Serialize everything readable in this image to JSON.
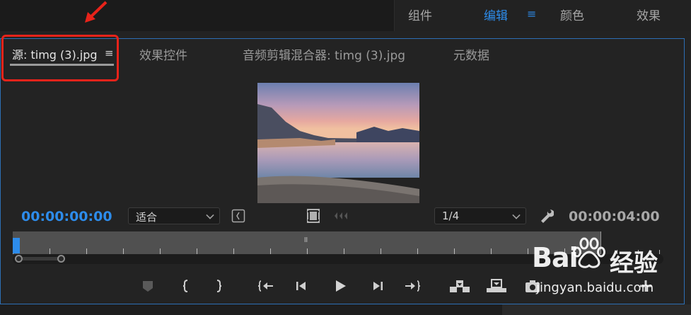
{
  "workspace_tabs": [
    "组件",
    "编辑",
    "颜色",
    "效果"
  ],
  "workspace_active": "编辑",
  "panel_tabs": {
    "source": "源: timg (3).jpg",
    "effect_controls": "效果控件",
    "audio_clip_mixer": "音频剪辑混合器: timg (3).jpg",
    "metadata": "元数据"
  },
  "timecode_in": "00:00:00:00",
  "timecode_duration": "00:00:04:00",
  "zoom_select": "适合",
  "resolution_select": "1/4",
  "watermark": {
    "brand": "Bai",
    "brand_suffix": "经验",
    "url": "jingyan.baidu.com"
  },
  "colors": {
    "accent": "#2d8ceb",
    "highlight": "#e8231a"
  }
}
